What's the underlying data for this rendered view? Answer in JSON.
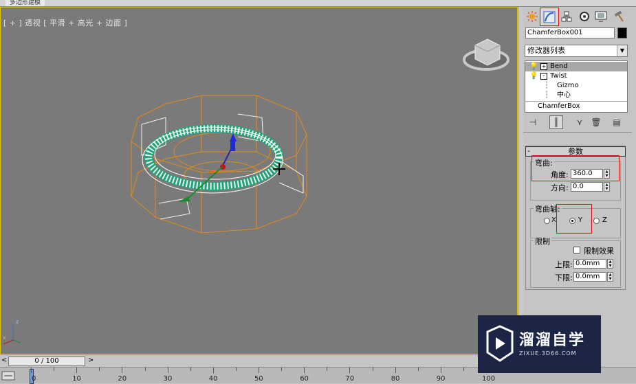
{
  "window": {
    "title_tab": "多边形建模"
  },
  "viewport": {
    "label": "[ + ] 透视 [ 平滑 + 高光 + 边面 ]",
    "axis_labels": {
      "z": "z",
      "x": "x"
    }
  },
  "command_panel": {
    "tabs": [
      {
        "name": "create",
        "icon": "sun-icon"
      },
      {
        "name": "modify",
        "icon": "modify-curve-icon",
        "active": true
      },
      {
        "name": "hierarchy",
        "icon": "hierarchy-icon"
      },
      {
        "name": "motion",
        "icon": "motion-icon"
      },
      {
        "name": "display",
        "icon": "display-icon"
      },
      {
        "name": "utilities",
        "icon": "hammer-icon"
      }
    ],
    "object_name": "ChamferBox001",
    "object_color": "#000000",
    "modifier_list_label": "修改器列表",
    "stack": {
      "bend": "Bend",
      "twist": "Twist",
      "gizmo": "Gizmo",
      "center": "中心",
      "base": "ChamferBox"
    }
  },
  "params": {
    "rollout_title": "参数",
    "collapse_symbol": "-",
    "bend_group": "弯曲:",
    "angle_label": "角度:",
    "angle_value": "360.0",
    "direction_label": "方向:",
    "direction_value": "0.0",
    "axis_group": "弯曲轴:",
    "axis_x": "X",
    "axis_y": "Y",
    "axis_z": "Z",
    "axis_selected": "Y",
    "limit_group": "限制",
    "limit_effect_label": "限制效果",
    "limit_effect_checked": false,
    "upper_label": "上限:",
    "upper_value": "0.0mm",
    "lower_label": "下限:",
    "lower_value": "0.0mm"
  },
  "timeline": {
    "position": "0 / 100",
    "prev_symbol": "<",
    "next_symbol": ">",
    "ruler_labels": [
      "0",
      "10",
      "20",
      "30",
      "40",
      "50",
      "60",
      "70",
      "80",
      "90",
      "100"
    ]
  },
  "watermark": {
    "title": "溜溜自学",
    "url": "ZIXUE.3D66.COM"
  },
  "colors": {
    "viewport_bg": "#7a7a7a",
    "active_border": "#e0c000",
    "highlight_red": "#e01010",
    "gizmo_orange": "#e08a1a",
    "mesh_green": "#1fa37a",
    "watermark_bg": "#1c2545"
  }
}
